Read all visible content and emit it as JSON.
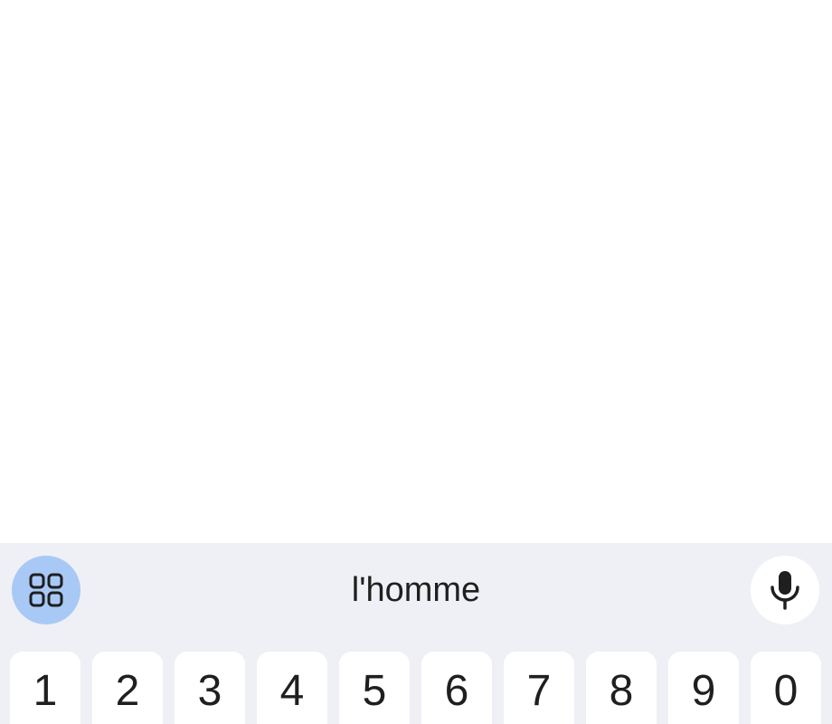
{
  "keyboard": {
    "suggestion": "l'homme",
    "icons": {
      "apps": "apps-grid-icon",
      "mic": "microphone-icon"
    },
    "colors": {
      "keyboard_background": "#eff0f5",
      "apps_button": "#a8c9f6",
      "key": "#ffffff",
      "text": "#1f1f1f"
    },
    "number_keys": [
      "1",
      "2",
      "3",
      "4",
      "5",
      "6",
      "7",
      "8",
      "9",
      "0"
    ]
  }
}
